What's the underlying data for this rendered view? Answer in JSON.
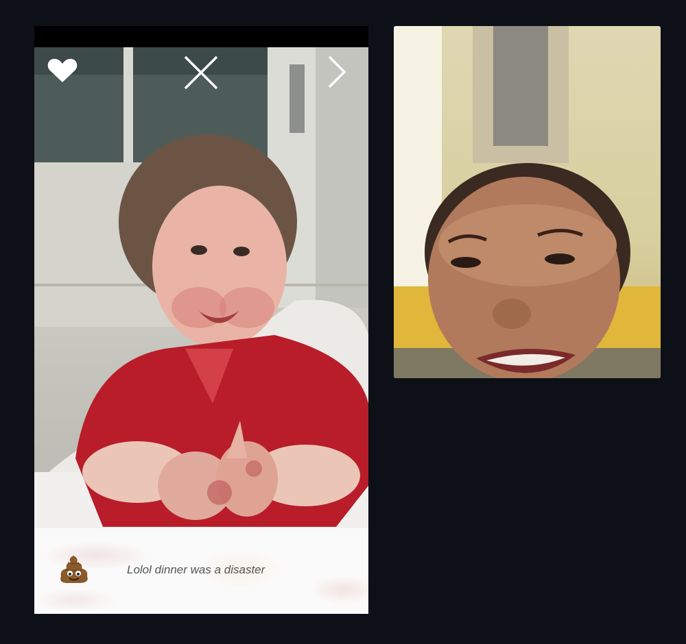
{
  "viewer": {
    "caption": {
      "emoji": "pile-of-poo-emoji",
      "text": "Lolol dinner was a disaster"
    },
    "controls": {
      "like_icon": "heart-icon",
      "close_icon": "close-x-icon",
      "next_icon": "chevron-right-icon"
    }
  },
  "video_call": {
    "remote_participant_icon": "participant-video"
  },
  "colors": {
    "background": "#0d1016",
    "icon_white": "#ffffff",
    "caption_text": "#555555"
  }
}
